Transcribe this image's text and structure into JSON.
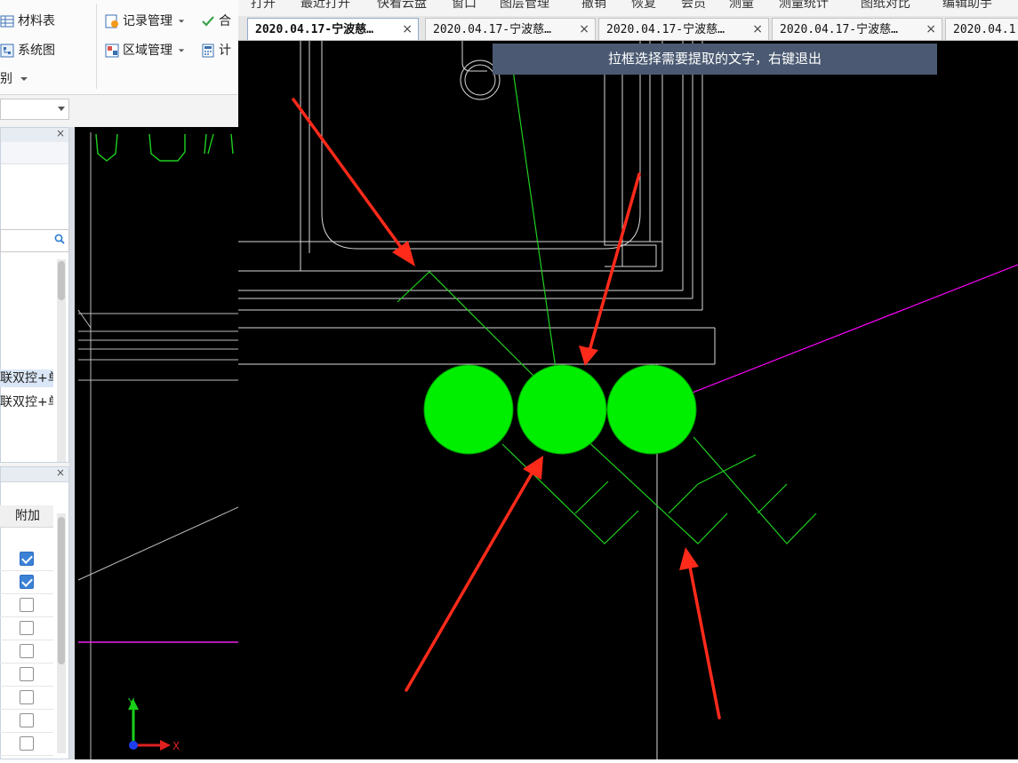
{
  "left_app": {
    "ribbon": {
      "items": [
        {
          "label": "材料表",
          "icon": "table-icon"
        },
        {
          "label": "系统图",
          "icon": "diagram-icon"
        },
        {
          "label": "别",
          "icon": "chevron-down-icon"
        },
        {
          "label": "记录管理",
          "icon": "record-manage-icon"
        },
        {
          "label": "区域管理",
          "icon": "region-manage-icon"
        },
        {
          "label": "合",
          "icon": "check-icon"
        },
        {
          "label": "计",
          "icon": "calculator-icon"
        }
      ]
    },
    "tree_items": [
      "联双控+单",
      "联双控+单"
    ],
    "grid": {
      "column_header": "附加",
      "checkboxes": [
        true,
        true,
        false,
        false,
        false,
        false,
        false,
        false,
        false
      ]
    },
    "axis": {
      "x_label": "X",
      "y_label": "Y"
    }
  },
  "top_app": {
    "menu": [
      "打开",
      "最近打开",
      "快看云盘",
      "窗口",
      "图层管理",
      "撤销",
      "恢复",
      "会员",
      "测量",
      "测量统计",
      "图纸对比",
      "编辑助手"
    ],
    "tabs": [
      {
        "label": "2020.04.17-宁波慈…",
        "active": true
      },
      {
        "label": "2020.04.17-宁波慈…",
        "active": false
      },
      {
        "label": "2020.04.17-宁波慈…",
        "active": false
      },
      {
        "label": "2020.04.17-宁波慈…",
        "active": false
      },
      {
        "label": "2020.04.1",
        "active": false
      }
    ],
    "tab_close_symbol": "×",
    "hint": "拉框选择需要提取的文字，右键退出"
  },
  "colors": {
    "cad_background": "#000000",
    "highlight_green": "#00ee00",
    "arrow_red": "#ff2a1a",
    "hint_bar": "#4b5a72",
    "magenta_line": "#ff00ff"
  }
}
